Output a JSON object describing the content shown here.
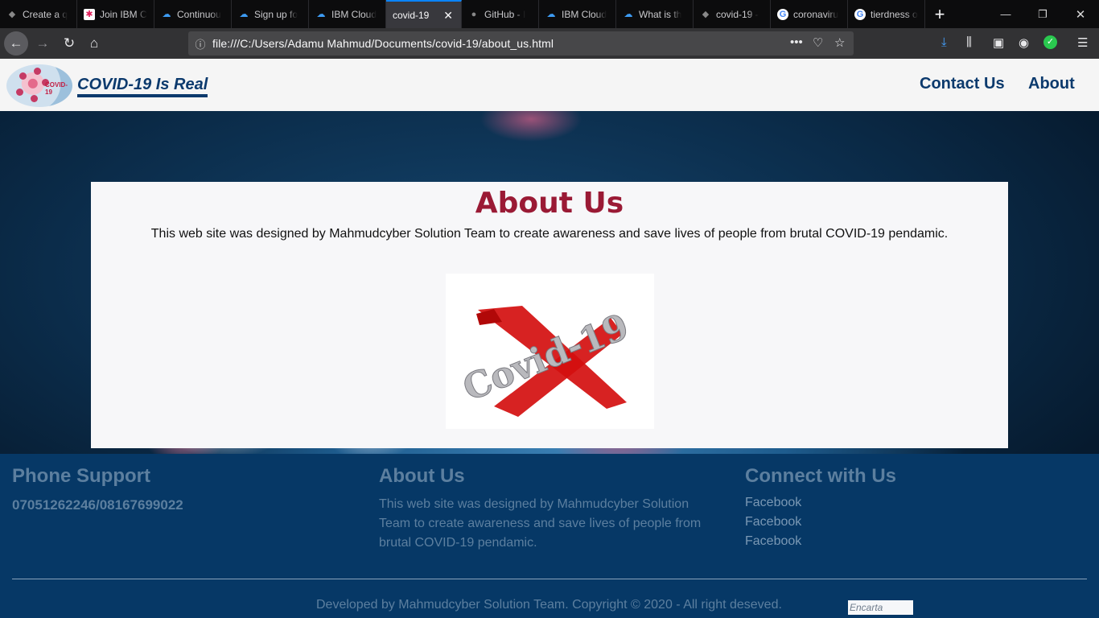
{
  "browser": {
    "tabs": [
      {
        "label": "Create a q",
        "icon": "github-icon"
      },
      {
        "label": "Join IBM C",
        "icon": "slack-icon"
      },
      {
        "label": "Continuou",
        "icon": "ibm-cloud-icon"
      },
      {
        "label": "Sign up fo",
        "icon": "ibm-cloud-icon"
      },
      {
        "label": "IBM Cloud",
        "icon": "ibm-cloud-icon"
      },
      {
        "label": "covid-19",
        "icon": "",
        "active": true
      },
      {
        "label": "GitHub - I",
        "icon": "github-icon"
      },
      {
        "label": "IBM Cloud",
        "icon": "ibm-cloud-icon"
      },
      {
        "label": "What is th",
        "icon": "ibm-cloud-icon"
      },
      {
        "label": "covid-19 -",
        "icon": "github-icon"
      },
      {
        "label": "coronaviru",
        "icon": "google-icon"
      },
      {
        "label": "tierdness o",
        "icon": "google-icon"
      }
    ],
    "url": "file:///C:/Users/Adamu Mahmud/Documents/covid-19/about_us.html",
    "accent": "#0a84ff"
  },
  "site": {
    "logo_text": "COVID-19",
    "brand": "COVID-19 Is Real",
    "nav": {
      "contact": "Contact Us",
      "about": "About"
    }
  },
  "main": {
    "title": "About Us",
    "description": "This web site was designed by Mahmudcyber Solution Team to create awareness and save lives of people from brutal COVID-19 pendamic.",
    "image_text": "Covid-19"
  },
  "footer": {
    "phone_title": "Phone Support",
    "phone": "07051262246/08167699022",
    "about_title": "About Us",
    "about_text": "This web site was designed by Mahmudcyber Solution Team to create awareness and save lives of people from brutal COVID-19 pendamic.",
    "connect_title": "Connect with Us",
    "links": [
      "Facebook",
      "Facebook",
      "Facebook"
    ],
    "copyright": "Developed by Mahmudcyber Solution Team. Copyright © 2020 - All right deseved.",
    "badge": "Encarta"
  },
  "colors": {
    "brand_blue": "#0c3a6d",
    "title_red": "#9a1a35",
    "footer_bg": "#063866"
  }
}
